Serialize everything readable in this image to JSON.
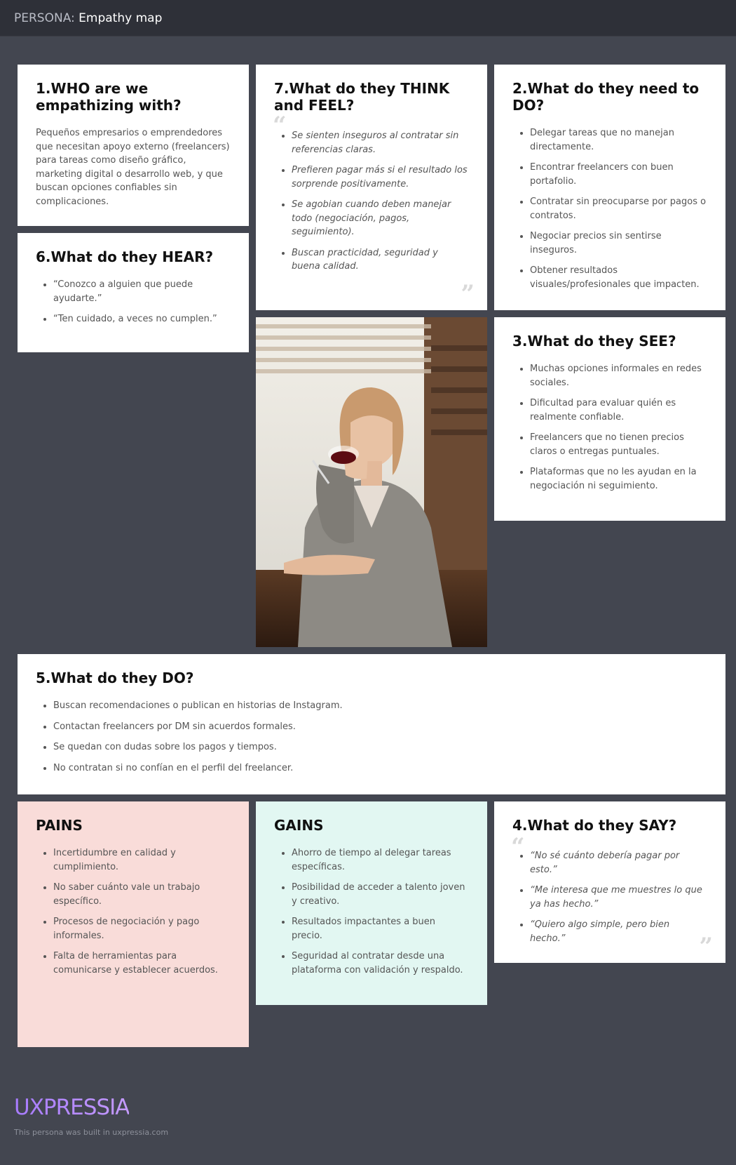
{
  "header": {
    "prefix": "PERSONA:",
    "title": "Empathy map"
  },
  "who": {
    "title": "1.WHO are we empathizing with?",
    "text": "Pequeños empresarios o emprendedores que necesitan apoyo externo (freelancers) para tareas como diseño gráfico, marketing digital o desarrollo web, y que buscan opciones confiables sin complicaciones."
  },
  "hear": {
    "title": "6.What do they HEAR?",
    "items": [
      "“Conozco a alguien que puede ayudarte.”",
      "“Ten cuidado, a veces no cumplen.”"
    ]
  },
  "think": {
    "title": "7.What do they THINK and FEEL?",
    "items": [
      "Se sienten inseguros al contratar sin referencias claras.",
      "Prefieren pagar más si el resultado los sorprende positivamente.",
      "Se agobian cuando deben manejar todo (negociación, pagos, seguimiento).",
      "Buscan practicidad, seguridad y buena calidad."
    ]
  },
  "need": {
    "title": "2.What do they need to DO?",
    "items": [
      "Delegar tareas que no manejan directamente.",
      "Encontrar freelancers con buen portafolio.",
      "Contratar sin preocuparse por pagos o contratos.",
      "Negociar precios sin sentirse inseguros.",
      "Obtener resultados visuales/profesionales que impacten."
    ]
  },
  "see": {
    "title": "3.What do they SEE?",
    "items": [
      "Muchas opciones informales en redes sociales.",
      "Dificultad para evaluar quién es realmente confiable.",
      "Freelancers que no tienen precios claros o entregas puntuales.",
      "Plataformas que no les ayudan en la negociación ni seguimiento."
    ]
  },
  "do": {
    "title": "5.What do they DO?",
    "items": [
      "Buscan recomendaciones o publican en historias de Instagram.",
      "Contactan freelancers por DM sin acuerdos formales.",
      "Se quedan con dudas sobre los pagos y tiempos.",
      "No contratan si no confían en el perfil del freelancer."
    ]
  },
  "pains": {
    "title": "PAINS",
    "items": [
      "Incertidumbre en calidad y cumplimiento.",
      "No saber cuánto vale un trabajo específico.",
      "Procesos de negociación y pago informales.",
      "Falta de herramientas para comunicarse y establecer acuerdos."
    ]
  },
  "gains": {
    "title": "GAINS",
    "items": [
      "Ahorro de tiempo al delegar tareas específicas.",
      "Posibilidad de acceder a talento joven y creativo.",
      "Resultados impactantes a buen precio.",
      "Seguridad al contratar desde una plataforma con validación y respaldo."
    ]
  },
  "say": {
    "title": "4.What do they SAY?",
    "items": [
      "“No sé cuánto debería pagar por esto.”",
      "“Me interesa que me muestres lo que ya has hecho.”",
      "“Quiero algo simple, pero bien hecho.”"
    ]
  },
  "footer": {
    "brand": "UXPRESSIA",
    "note": "This persona was built in uxpressia.com"
  },
  "colors": {
    "pains_bg": "#f9dcd9",
    "gains_bg": "#e2f7f2",
    "brand": "#b68cff",
    "page_bg": "#434650"
  }
}
